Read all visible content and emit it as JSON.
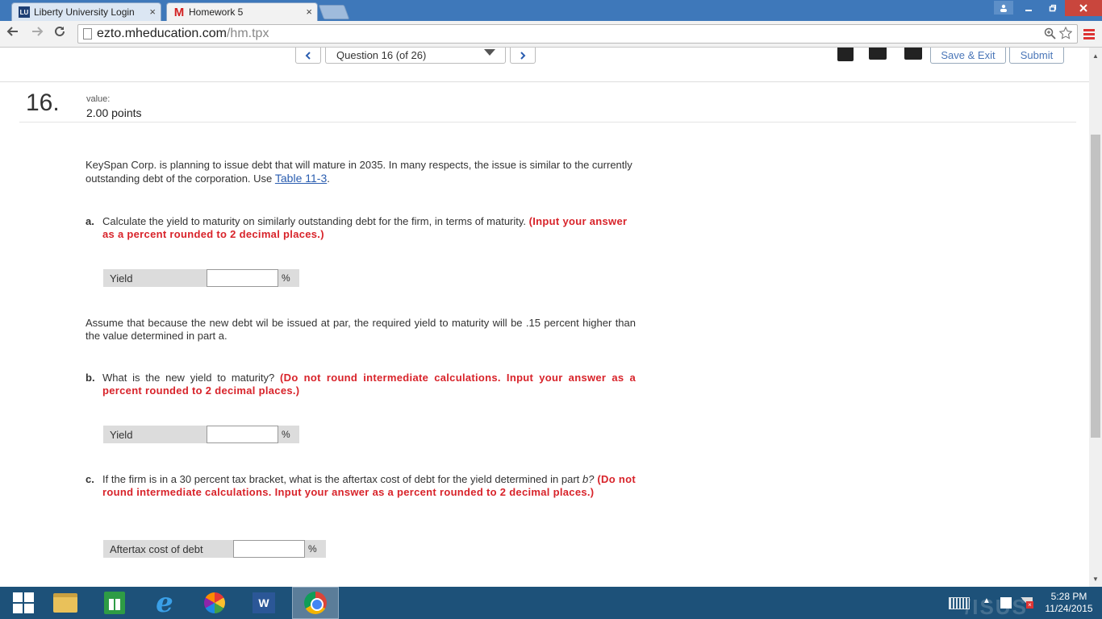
{
  "browser": {
    "tabs": [
      {
        "title": "Liberty University Login",
        "favicon": "LU",
        "active": false
      },
      {
        "title": "Homework 5",
        "favicon": "M",
        "active": true
      }
    ],
    "tab_close_glyph": "×",
    "url_domain": "ezto.mheducation.com",
    "url_path": "/hm.tpx"
  },
  "header": {
    "question_select": "Question 16 (of 26)",
    "save_exit_label": "Save & Exit",
    "submit_label": "Submit"
  },
  "question": {
    "number": "16.",
    "value_label": "value:",
    "points": "2.00 points",
    "intro": "KeySpan Corp. is planning to issue debt that will mature in 2035. In many respects, the issue is similar to the currently outstanding debt of the corporation. Use ",
    "intro_link": "Table 11-3",
    "intro_end": ".",
    "assume_text": "Assume that because the new debt wil be issued at par, the required yield to maturity will be .15 percent higher than the value determined in part a.",
    "parts": [
      {
        "letter": "a.",
        "text": "Calculate the yield to maturity on similarly outstanding debt for the firm, in terms of maturity. ",
        "instruction": "(Input your answer as a percent rounded to 2 decimal places.)",
        "answer_label": "Yield",
        "answer_value": "",
        "unit": "%"
      },
      {
        "letter": "b.",
        "text": "What is the new yield to maturity? ",
        "instruction": "(Do not round intermediate calculations. Input your answer as a percent rounded to 2 decimal places.)",
        "answer_label": "Yield",
        "answer_value": "",
        "unit": "%"
      },
      {
        "letter": "c.",
        "text": "If the firm is in a 30 percent tax bracket, what is the aftertax cost of debt for the yield determined in part ",
        "text_italic": "b?",
        "instruction": " (Do not round intermediate calculations. Input your answer as a percent rounded to 2 decimal places.)",
        "answer_label": "Aftertax cost of debt",
        "answer_value": "",
        "unit": "%"
      }
    ]
  },
  "taskbar": {
    "word_label": "W",
    "clock_time": "5:28 PM",
    "clock_date": "11/24/2015"
  },
  "colors": {
    "accent_link": "#2a5db0",
    "instruction_red": "#d8232a",
    "taskbar": "#1d5179"
  }
}
